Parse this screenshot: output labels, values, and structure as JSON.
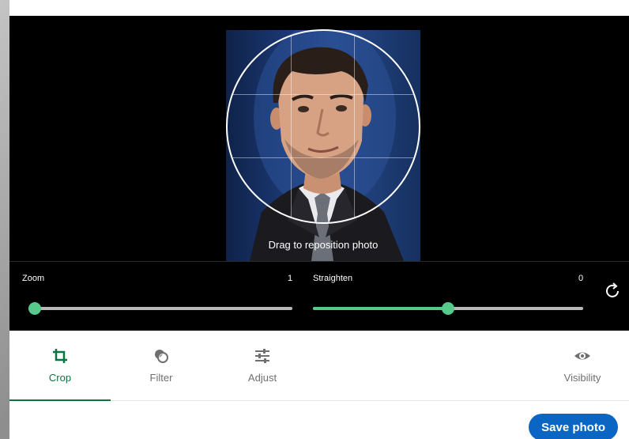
{
  "editor": {
    "drag_hint": "Drag to reposition photo",
    "zoom": {
      "label": "Zoom",
      "value": "1",
      "fraction": 0.0
    },
    "straighten": {
      "label": "Straighten",
      "value": "0",
      "fraction": 0.5
    }
  },
  "tabs": [
    {
      "label": "Crop",
      "icon": "crop-icon",
      "active": true
    },
    {
      "label": "Filter",
      "icon": "filter-icon",
      "active": false
    },
    {
      "label": "Adjust",
      "icon": "adjust-icon",
      "active": false
    },
    {
      "label": "Visibility",
      "icon": "eye-icon",
      "active": false
    }
  ],
  "footer": {
    "save_label": "Save photo"
  },
  "colors": {
    "accent_green": "#57c98a",
    "tab_active": "#057642",
    "primary_blue": "#0a66c2"
  }
}
